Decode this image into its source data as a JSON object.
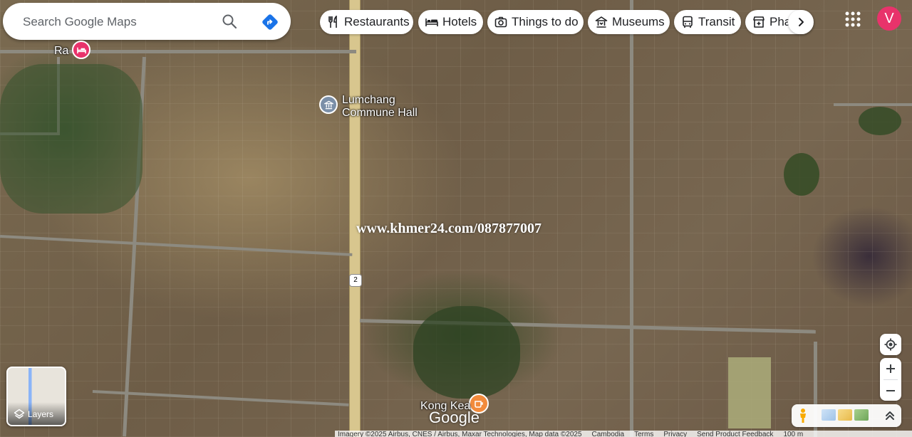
{
  "search": {
    "placeholder": "Search Google Maps"
  },
  "chips": [
    {
      "label": "Restaurants",
      "icon": "fork-knife-icon"
    },
    {
      "label": "Hotels",
      "icon": "bed-icon"
    },
    {
      "label": "Things to do",
      "icon": "camera-icon"
    },
    {
      "label": "Museums",
      "icon": "museum-icon"
    },
    {
      "label": "Transit",
      "icon": "bus-icon"
    },
    {
      "label": "Pharmacies",
      "icon": "pharmacy-icon"
    }
  ],
  "account": {
    "initial": "V",
    "color": "#e8336b"
  },
  "places": {
    "top_left_label": "Ra",
    "commune_hall": "Lumchang\nCommune Hall",
    "kong_kea": "Kong Kea"
  },
  "road_shield": "2",
  "watermark": "www.khmer24.com/087877007",
  "layers": {
    "label": "Layers"
  },
  "branding": {
    "logo": "Google"
  },
  "attribution": {
    "imagery": "Imagery ©2025 Airbus, CNES / Airbus, Maxar Technologies, Map data ©2025",
    "country": "Cambodia",
    "terms": "Terms",
    "privacy": "Privacy",
    "feedback": "Send Product Feedback",
    "scale": "100 m"
  },
  "colors": {
    "accent": "#1a73e8",
    "directions": "#1a73e8",
    "landmark_pin": "#7b8fa8",
    "hotel_pin": "#e8336b",
    "food_pin": "#f28b3c"
  }
}
